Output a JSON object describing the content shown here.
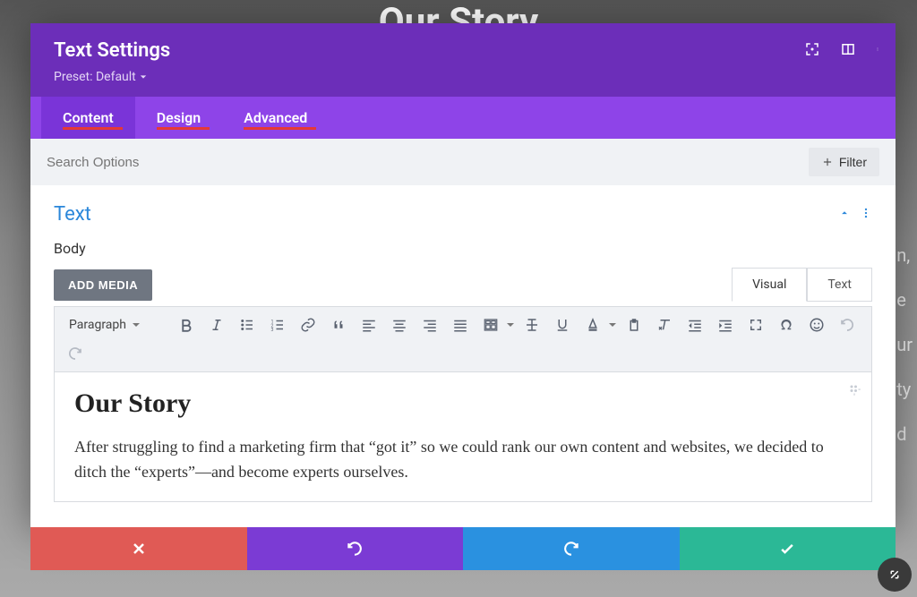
{
  "bg": {
    "heading": "Our Story",
    "right_fragments": [
      "n,",
      "e",
      "ur",
      "ty",
      "d"
    ]
  },
  "header": {
    "title": "Text Settings",
    "preset_label": "Preset: Default"
  },
  "tabs": {
    "content": "Content",
    "design": "Design",
    "advanced": "Advanced"
  },
  "search": {
    "placeholder": "Search Options",
    "filter": "Filter"
  },
  "section": {
    "title": "Text",
    "body_label": "Body",
    "add_media": "ADD MEDIA"
  },
  "editor_tabs": {
    "visual": "Visual",
    "text": "Text"
  },
  "toolbar": {
    "format_select": "Paragraph"
  },
  "content": {
    "heading": "Our Story",
    "body": "After struggling to find a marketing firm that “got it” so we could rank our own content and websites, we decided to ditch the “experts”—and become experts ourselves."
  }
}
